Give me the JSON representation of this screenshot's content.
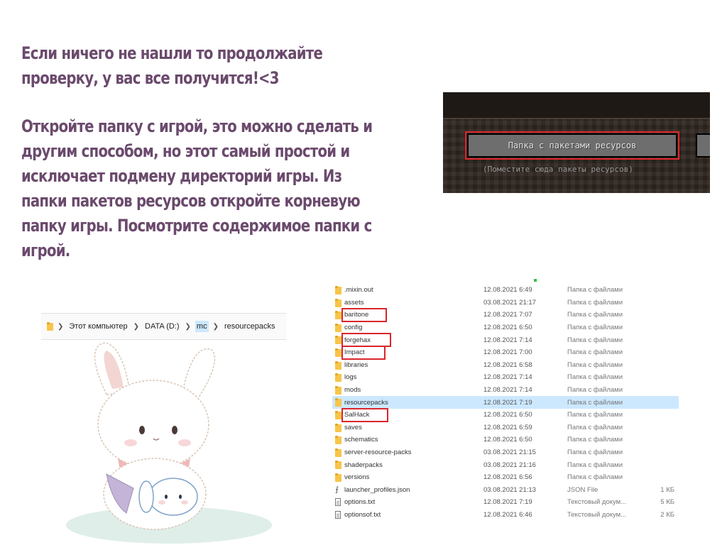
{
  "instructions": {
    "para1": "Если ничего не нашли то продолжайте проверку, у вас все получится!<3",
    "para2": "Откройте папку с игрой, это можно сделать и другим способом, но этот самый простой и исключает подмену директорий игры. Из папки пакетов ресурсов откройте корневую папку игры. Посмотрите содержимое папки с игрой."
  },
  "minecraft": {
    "button_label": "Папка с пакетами ресурсов",
    "hint": "(Поместите сюда пакеты ресурсов)"
  },
  "explorer": {
    "breadcrumbs": [
      "Этот компьютер",
      "DATA (D:)",
      "mc",
      "resourcepacks"
    ]
  },
  "files": [
    {
      "name": ".mixin.out",
      "date": "12.08.2021 6:49",
      "type": "Папка с файлами",
      "size": "",
      "icon": "folder-icon"
    },
    {
      "name": "assets",
      "date": "03.08.2021 21:17",
      "type": "Папка с файлами",
      "size": "",
      "icon": "folder-icon"
    },
    {
      "name": "baritone",
      "date": "12.08.2021 7:07",
      "type": "Папка с файлами",
      "size": "",
      "icon": "folder-icon"
    },
    {
      "name": "config",
      "date": "12.08.2021 6:50",
      "type": "Папка с файлами",
      "size": "",
      "icon": "folder-icon"
    },
    {
      "name": "forgehax",
      "date": "12.08.2021 7:14",
      "type": "Папка с файлами",
      "size": "",
      "icon": "folder-icon"
    },
    {
      "name": "Impact",
      "date": "12.08.2021 7:00",
      "type": "Папка с файлами",
      "size": "",
      "icon": "folder-icon"
    },
    {
      "name": "libraries",
      "date": "12.08.2021 6:58",
      "type": "Папка с файлами",
      "size": "",
      "icon": "folder-icon"
    },
    {
      "name": "logs",
      "date": "12.08.2021 7:14",
      "type": "Папка с файлами",
      "size": "",
      "icon": "folder-icon"
    },
    {
      "name": "mods",
      "date": "12.08.2021 7:14",
      "type": "Папка с файлами",
      "size": "",
      "icon": "folder-icon"
    },
    {
      "name": "resourcepacks",
      "date": "12.08.2021 7:19",
      "type": "Папка с файлами",
      "size": "",
      "icon": "folder-icon",
      "selected": true
    },
    {
      "name": "SalHack",
      "date": "12.08.2021 6:50",
      "type": "Папка с файлами",
      "size": "",
      "icon": "folder-icon"
    },
    {
      "name": "saves",
      "date": "12.08.2021 6:59",
      "type": "Папка с файлами",
      "size": "",
      "icon": "folder-icon"
    },
    {
      "name": "schematics",
      "date": "12.08.2021 6:50",
      "type": "Папка с файлами",
      "size": "",
      "icon": "folder-icon"
    },
    {
      "name": "server-resource-packs",
      "date": "03.08.2021 21:15",
      "type": "Папка с файлами",
      "size": "",
      "icon": "folder-icon"
    },
    {
      "name": "shaderpacks",
      "date": "03.08.2021 21:16",
      "type": "Папка с файлами",
      "size": "",
      "icon": "folder-icon"
    },
    {
      "name": "versions",
      "date": "12.08.2021 6:56",
      "type": "Папка с файлами",
      "size": "",
      "icon": "folder-icon"
    },
    {
      "name": "launcher_profiles.json",
      "date": "03.08.2021 21:13",
      "type": "JSON File",
      "size": "1 КБ",
      "icon": "json-file-icon"
    },
    {
      "name": "options.txt",
      "date": "12.08.2021 7:19",
      "type": "Текстовый докум...",
      "size": "5 КБ",
      "icon": "text-file-icon"
    },
    {
      "name": "optionsof.txt",
      "date": "12.08.2021 6:46",
      "type": "Текстовый докум...",
      "size": "2 КБ",
      "icon": "text-file-icon"
    }
  ],
  "colors": {
    "heading_text": "#6b4a6d",
    "highlight_red": "#d9262b",
    "selection_blue": "#cce8ff"
  }
}
